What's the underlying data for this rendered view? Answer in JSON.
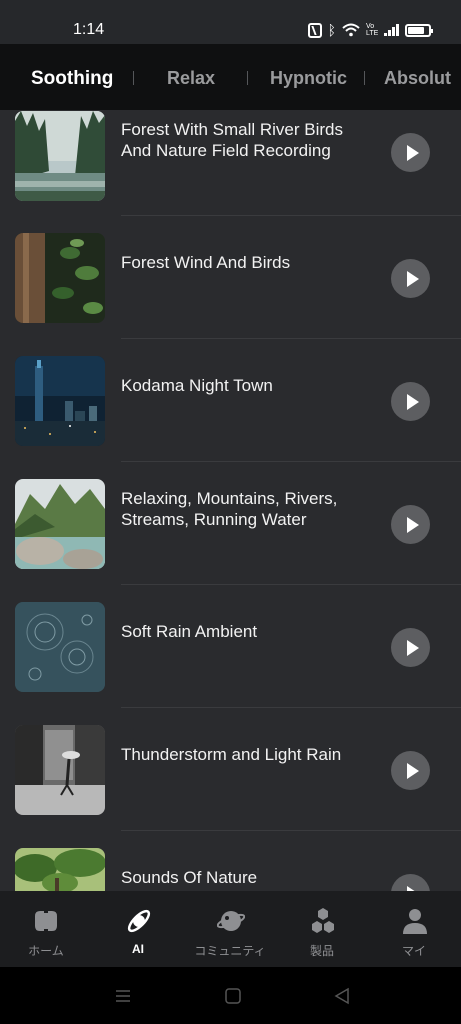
{
  "status": {
    "time": "1:14",
    "volte": "Vo LTE",
    "battery_level": 0.8
  },
  "tabs": [
    {
      "label": "Soothing",
      "active": true
    },
    {
      "label": "Relax",
      "active": false
    },
    {
      "label": "Hypnotic",
      "active": false
    },
    {
      "label": "Absolut",
      "active": false
    }
  ],
  "tracks": [
    {
      "title": "Forest With Small River Birds And Nature Field Recording",
      "thumb": "forest-river"
    },
    {
      "title": "Forest Wind And Birds",
      "thumb": "forest-leaves"
    },
    {
      "title": "Kodama Night Town",
      "thumb": "night-city"
    },
    {
      "title": "Relaxing, Mountains, Rivers, Streams, Running Water",
      "thumb": "mountain-river"
    },
    {
      "title": "Soft Rain Ambient",
      "thumb": "rain-puddle"
    },
    {
      "title": "Thunderstorm and Light Rain",
      "thumb": "rainy-street-bw"
    },
    {
      "title": "Sounds Of Nature",
      "thumb": "green-canopy"
    }
  ],
  "bottom_nav": [
    {
      "label": "ホーム",
      "icon": "brain-icon",
      "active": false
    },
    {
      "label": "AI",
      "icon": "orbit-icon",
      "active": true
    },
    {
      "label": "コミュニティ",
      "icon": "planet-icon",
      "active": false
    },
    {
      "label": "製品",
      "icon": "hexagons-icon",
      "active": false
    },
    {
      "label": "マイ",
      "icon": "person-icon",
      "active": false
    }
  ],
  "colors": {
    "background": "#2a2b2e",
    "tab_bar": "#0f1011",
    "play_button": "#5d5e61",
    "nav_bar": "#1c1d1f"
  }
}
